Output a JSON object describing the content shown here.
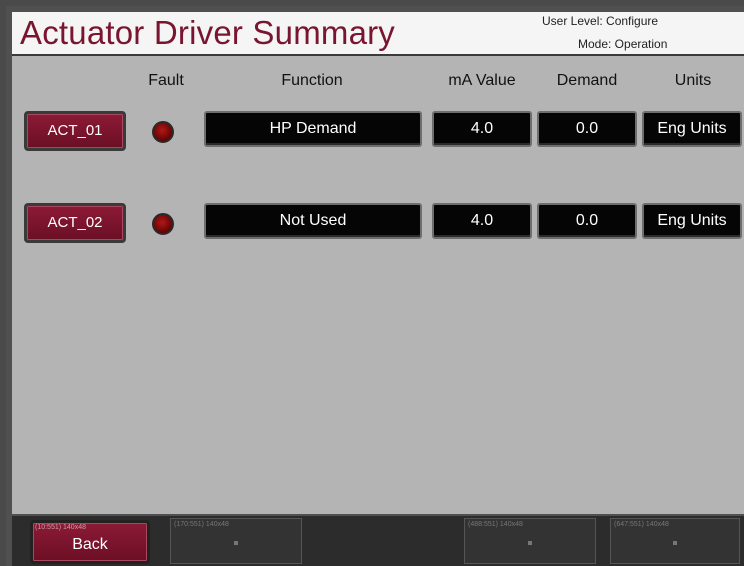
{
  "header": {
    "title": "Actuator Driver Summary",
    "user_level": "User Level: Configure",
    "mode": "Mode: Operation"
  },
  "columns": {
    "fault": "Fault",
    "function": "Function",
    "ma_value": "mA Value",
    "demand": "Demand",
    "units": "Units"
  },
  "rows": [
    {
      "name": "ACT_01",
      "function": "HP Demand",
      "ma_value": "4.0",
      "demand": "0.0",
      "units": "Eng Units"
    },
    {
      "name": "ACT_02",
      "function": "Not Used",
      "ma_value": "4.0",
      "demand": "0.0",
      "units": "Eng Units"
    }
  ],
  "footer": {
    "back_label": "Back",
    "back_tag": "(10:551) 140x48",
    "slot2_tag": "(170:551) 140x48",
    "slot3_tag": "(488:551) 140x48",
    "slot4_tag": "(647:551) 140x48"
  },
  "colors": {
    "accent": "#7a1530",
    "fault_led": "#8a0a0a"
  }
}
